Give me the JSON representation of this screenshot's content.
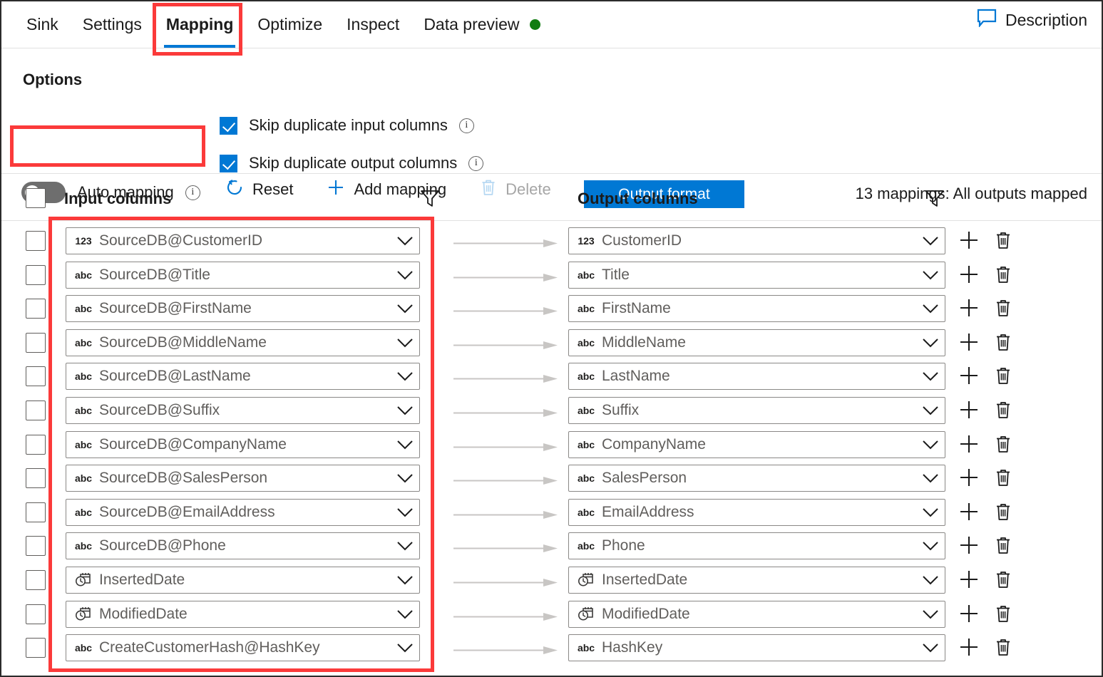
{
  "tabs": [
    {
      "label": "Sink",
      "active": false,
      "status_dot": false
    },
    {
      "label": "Settings",
      "active": false,
      "status_dot": false
    },
    {
      "label": "Mapping",
      "active": true,
      "status_dot": false
    },
    {
      "label": "Optimize",
      "active": false,
      "status_dot": false
    },
    {
      "label": "Inspect",
      "active": false,
      "status_dot": false
    },
    {
      "label": "Data preview",
      "active": false,
      "status_dot": true
    }
  ],
  "header": {
    "description_label": "Description",
    "description_icon": "comment-icon",
    "status_dot_color": "#107c10"
  },
  "options": {
    "section_label": "Options",
    "skip_duplicate_input": {
      "label": "Skip duplicate input columns",
      "checked": true,
      "info_icon": "info-icon"
    },
    "skip_duplicate_output": {
      "label": "Skip duplicate output columns",
      "checked": true,
      "info_icon": "info-icon"
    },
    "auto_mapping": {
      "label": "Auto mapping",
      "enabled": false,
      "info_icon": "info-icon"
    }
  },
  "toolbar": {
    "reset_label": "Reset",
    "reset_icon": "refresh-icon",
    "add_mapping_label": "Add mapping",
    "add_mapping_icon": "plus-icon",
    "delete_label": "Delete",
    "delete_icon": "trash-icon",
    "delete_disabled": true,
    "output_format_label": "Output format",
    "mapping_status": "13 mappings: All outputs mapped",
    "primary_color": "#0078d4"
  },
  "table": {
    "input_header": "Input columns",
    "output_header": "Output columns",
    "filter_icon": "funnel-icon",
    "select_all_checked": false,
    "rows": [
      {
        "checked": false,
        "input_type": "123",
        "input": "SourceDB@CustomerID",
        "output_type": "123",
        "output": "CustomerID"
      },
      {
        "checked": false,
        "input_type": "abc",
        "input": "SourceDB@Title",
        "output_type": "abc",
        "output": "Title"
      },
      {
        "checked": false,
        "input_type": "abc",
        "input": "SourceDB@FirstName",
        "output_type": "abc",
        "output": "FirstName"
      },
      {
        "checked": false,
        "input_type": "abc",
        "input": "SourceDB@MiddleName",
        "output_type": "abc",
        "output": "MiddleName"
      },
      {
        "checked": false,
        "input_type": "abc",
        "input": "SourceDB@LastName",
        "output_type": "abc",
        "output": "LastName"
      },
      {
        "checked": false,
        "input_type": "abc",
        "input": "SourceDB@Suffix",
        "output_type": "abc",
        "output": "Suffix"
      },
      {
        "checked": false,
        "input_type": "abc",
        "input": "SourceDB@CompanyName",
        "output_type": "abc",
        "output": "CompanyName"
      },
      {
        "checked": false,
        "input_type": "abc",
        "input": "SourceDB@SalesPerson",
        "output_type": "abc",
        "output": "SalesPerson"
      },
      {
        "checked": false,
        "input_type": "abc",
        "input": "SourceDB@EmailAddress",
        "output_type": "abc",
        "output": "EmailAddress"
      },
      {
        "checked": false,
        "input_type": "abc",
        "input": "SourceDB@Phone",
        "output_type": "abc",
        "output": "Phone"
      },
      {
        "checked": false,
        "input_type": "date",
        "input": "InsertedDate",
        "output_type": "date",
        "output": "InsertedDate"
      },
      {
        "checked": false,
        "input_type": "date",
        "input": "ModifiedDate",
        "output_type": "date",
        "output": "ModifiedDate"
      },
      {
        "checked": false,
        "input_type": "abc",
        "input": "CreateCustomerHash@HashKey",
        "output_type": "abc",
        "output": "HashKey"
      }
    ],
    "row_add_icon": "plus-icon",
    "row_delete_icon": "trash-icon",
    "mapping_arrow_icon": "arrow-right-icon"
  },
  "annotations": {
    "highlight_color": "#fb3a3a",
    "boxes": [
      {
        "name": "mapping-tab-highlight"
      },
      {
        "name": "auto-mapping-highlight"
      },
      {
        "name": "input-columns-highlight"
      }
    ]
  }
}
